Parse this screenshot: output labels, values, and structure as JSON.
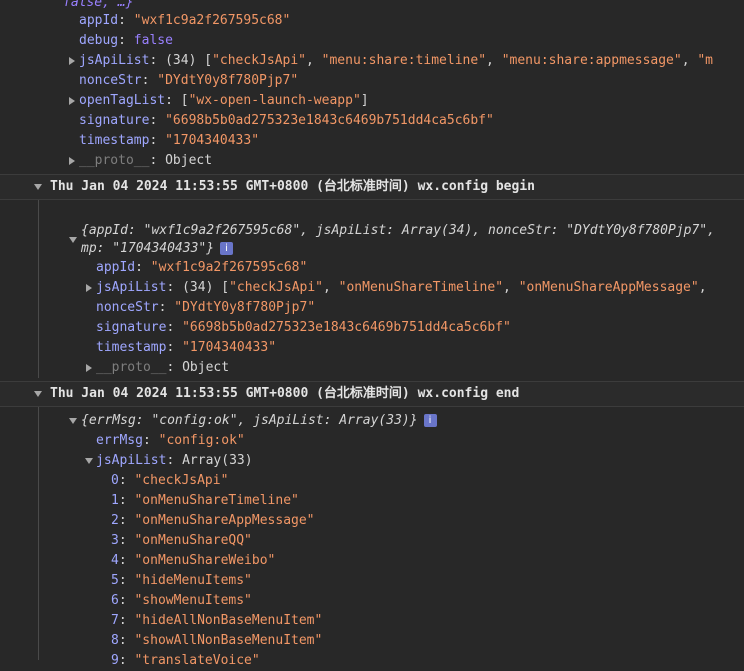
{
  "top_object": {
    "preview_tail": "false, …}",
    "props": [
      {
        "key": "appId",
        "sep": ": ",
        "value": "\"wxf1c9a2f267595c68\"",
        "type": "str",
        "expandable": false
      },
      {
        "key": "debug",
        "sep": ": ",
        "value": "false",
        "type": "bool",
        "expandable": false
      },
      {
        "key": "jsApiList",
        "sep": ": ",
        "value": "(34) [\"checkJsApi\", \"menu:share:timeline\", \"menu:share:appmessage\", \"m",
        "type": "mixed",
        "expandable": true
      },
      {
        "key": "nonceStr",
        "sep": ": ",
        "value": "\"DYdtY0y8f780Pjp7\"",
        "type": "str",
        "expandable": false
      },
      {
        "key": "openTagList",
        "sep": ": ",
        "value": "[\"wx-open-launch-weapp\"]",
        "type": "mixed",
        "expandable": true
      },
      {
        "key": "signature",
        "sep": ": ",
        "value": "\"6698b5b0ad275323e1843c6469b751dd4ca5c6bf\"",
        "type": "str",
        "expandable": false
      },
      {
        "key": "timestamp",
        "sep": ": ",
        "value": "\"1704340433\"",
        "type": "str",
        "expandable": false
      },
      {
        "key": "__proto__",
        "sep": ": ",
        "value": "Object",
        "type": "plain",
        "expandable": true,
        "dim": true
      }
    ]
  },
  "group_begin": {
    "title": "Thu Jan 04 2024 11:53:55 GMT+0800 (台北标准时间) wx.config begin",
    "summary_line1": "{appId: \"wxf1c9a2f267595c68\", jsApiList: Array(34), nonceStr: \"DYdtY0y8f780Pjp7\",",
    "summary_line2": "mp: \"1704340433\"}",
    "props": [
      {
        "key": "appId",
        "sep": ": ",
        "value": "\"wxf1c9a2f267595c68\"",
        "type": "str",
        "expandable": false
      },
      {
        "key": "jsApiList",
        "sep": ": ",
        "value": "(34) [\"checkJsApi\", \"onMenuShareTimeline\", \"onMenuShareAppMessage\",",
        "type": "mixed",
        "expandable": true
      },
      {
        "key": "nonceStr",
        "sep": ": ",
        "value": "\"DYdtY0y8f780Pjp7\"",
        "type": "str",
        "expandable": false
      },
      {
        "key": "signature",
        "sep": ": ",
        "value": "\"6698b5b0ad275323e1843c6469b751dd4ca5c6bf\"",
        "type": "str",
        "expandable": false
      },
      {
        "key": "timestamp",
        "sep": ": ",
        "value": "\"1704340433\"",
        "type": "str",
        "expandable": false
      },
      {
        "key": "__proto__",
        "sep": ": ",
        "value": "Object",
        "type": "plain",
        "expandable": true,
        "dim": true
      }
    ]
  },
  "group_end": {
    "title": "Thu Jan 04 2024 11:53:55 GMT+0800 (台北标准时间) wx.config end",
    "summary": "{errMsg: \"config:ok\", jsApiList: Array(33)}",
    "errMsg_key": "errMsg",
    "errMsg_value": "\"config:ok\"",
    "jsApiList_key": "jsApiList",
    "jsApiList_value": "Array(33)",
    "items": [
      {
        "index": "0",
        "value": "\"checkJsApi\""
      },
      {
        "index": "1",
        "value": "\"onMenuShareTimeline\""
      },
      {
        "index": "2",
        "value": "\"onMenuShareAppMessage\""
      },
      {
        "index": "3",
        "value": "\"onMenuShareQQ\""
      },
      {
        "index": "4",
        "value": "\"onMenuShareWeibo\""
      },
      {
        "index": "5",
        "value": "\"hideMenuItems\""
      },
      {
        "index": "6",
        "value": "\"showMenuItems\""
      },
      {
        "index": "7",
        "value": "\"hideAllNonBaseMenuItem\""
      },
      {
        "index": "8",
        "value": "\"showAllNonBaseMenuItem\""
      },
      {
        "index": "9",
        "value": "\"translateVoice\""
      }
    ]
  },
  "info_icon": "i",
  "colors": {
    "background": "#282828",
    "key": "#9fa7ff",
    "string": "#f29766",
    "boolean": "#9980ff",
    "text": "#d5d5d5"
  }
}
